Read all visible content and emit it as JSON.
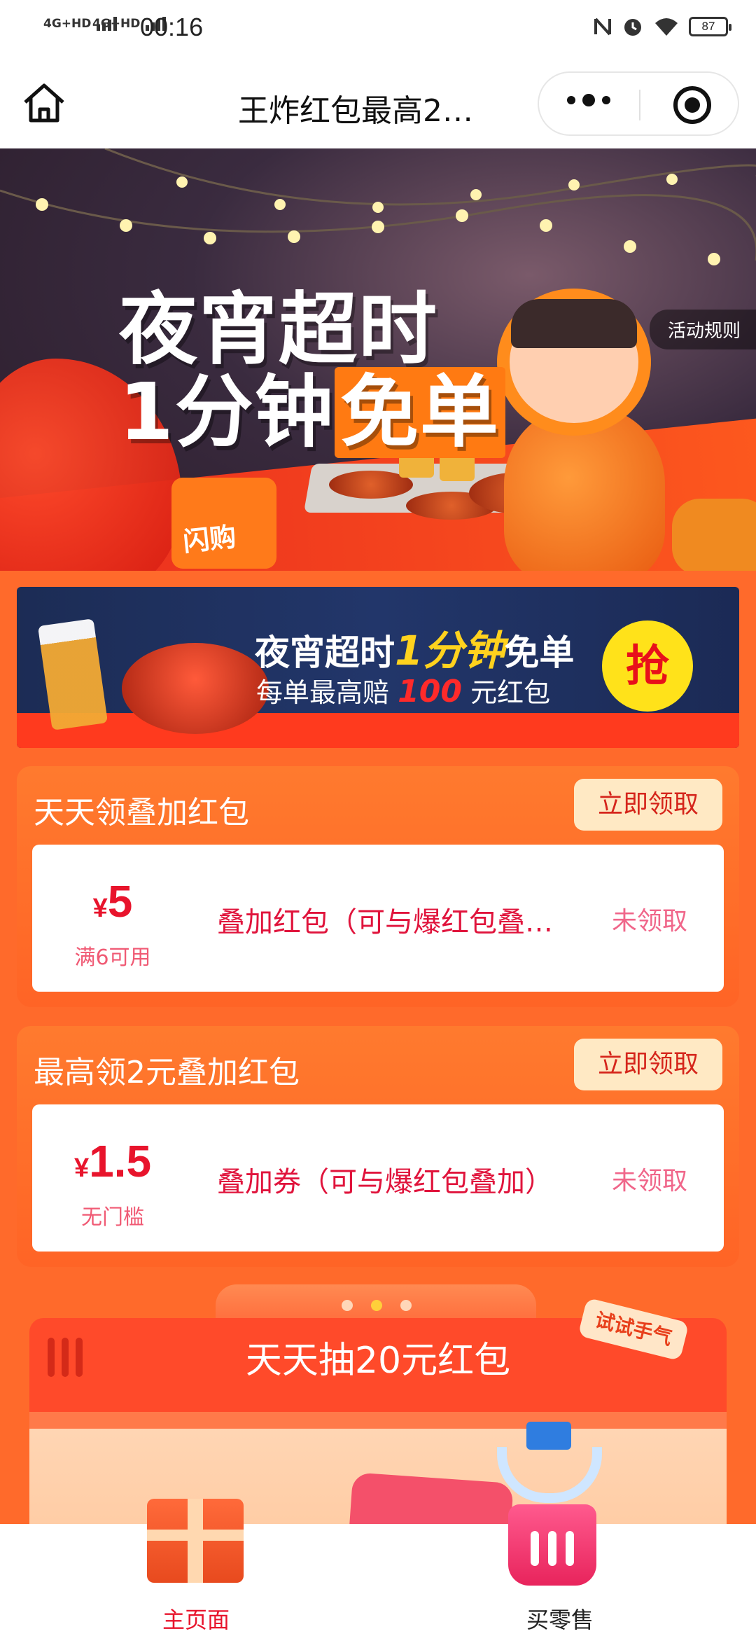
{
  "status_bar": {
    "signal_1": "4G+HD",
    "signal_2": "4G+HD",
    "time": "00:16",
    "battery": "87",
    "icons": [
      "nfc-icon",
      "alarm-icon",
      "wifi-icon",
      "battery-icon"
    ]
  },
  "nav": {
    "title": "王炸红包最高2…",
    "icons": [
      "home-icon",
      "more-dots-icon",
      "close-target-icon"
    ]
  },
  "hero": {
    "title_line1": "夜宵超时",
    "title_line2_a": "1分钟",
    "title_line2_b": "免单",
    "box_label": "闪购",
    "rules_button": "活动规则"
  },
  "promo_banner": {
    "line1_a": "夜宵超时",
    "line1_b": "1分钟",
    "line1_c": "免单",
    "line2_a": "每单最高赔",
    "line2_b": "100",
    "line2_c": "元红包",
    "grab_button": "抢"
  },
  "cards": [
    {
      "title": "天天领叠加红包",
      "claim_button": "立即领取",
      "coupon": {
        "currency": "¥",
        "amount": "5",
        "condition": "满6可用",
        "name": "叠加红包（可与爆红包叠…",
        "status": "未领取"
      }
    },
    {
      "title": "最高领2元叠加红包",
      "claim_button": "立即领取",
      "coupon": {
        "currency": "¥",
        "amount": "1.5",
        "condition": "无门槛",
        "name": "叠加券（可与爆红包叠加）",
        "status": "未领取"
      }
    }
  ],
  "lottery": {
    "title": "天天抽20元红包",
    "tag": "试试手气"
  },
  "tabbar": {
    "items": [
      {
        "label": "主页面",
        "icon": "gift-box-icon",
        "color": "#e8142c"
      },
      {
        "label": "买零售",
        "icon": "basket-icon",
        "color": "#222222"
      }
    ]
  },
  "colors": {
    "page_bg": "#ff6a2b",
    "accent_red": "#e8142c",
    "claim_bg": "#ffe9c4"
  }
}
